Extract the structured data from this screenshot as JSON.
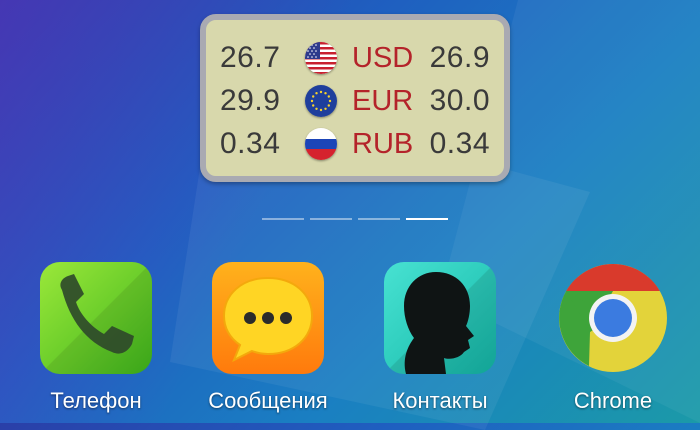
{
  "widget": {
    "rows": [
      {
        "buy": "26.7",
        "code": "USD",
        "sell": "26.9",
        "flag_icon": "us-flag-icon"
      },
      {
        "buy": "29.9",
        "code": "EUR",
        "sell": "30.0",
        "flag_icon": "eu-flag-icon"
      },
      {
        "buy": "0.34",
        "code": "RUB",
        "sell": "0.34",
        "flag_icon": "ru-flag-icon"
      }
    ],
    "colors": {
      "background": "#d8d8ac",
      "border": "#a9aab2",
      "code": "#b4232a"
    }
  },
  "page_indicator": {
    "count": 4,
    "active_index": 3
  },
  "apps": [
    {
      "label": "Телефон",
      "icon": "phone-icon"
    },
    {
      "label": "Сообщения",
      "icon": "messages-icon"
    },
    {
      "label": "Контакты",
      "icon": "contacts-icon"
    },
    {
      "label": "Chrome",
      "icon": "chrome-icon"
    }
  ]
}
